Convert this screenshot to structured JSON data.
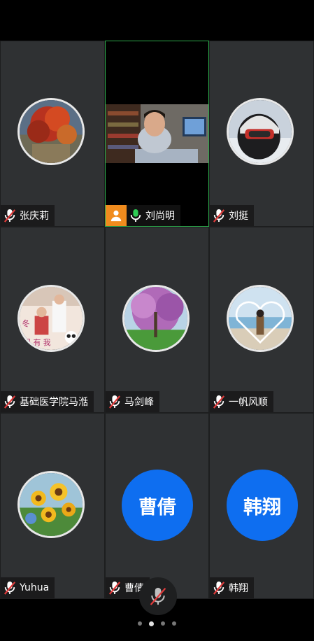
{
  "participants": [
    {
      "name": "张庆莉",
      "muted": true,
      "avatar": "red-maple-tree-photo"
    },
    {
      "name": "刘尚明",
      "muted": false,
      "host": true,
      "video": true
    },
    {
      "name": "刘挺",
      "muted": true,
      "avatar": "ski-helmet-selfie-photo"
    },
    {
      "name": "基础医学院马湉",
      "muted": true,
      "avatar": "family-illustration-photo"
    },
    {
      "name": "马剑峰",
      "muted": true,
      "avatar": "purple-blossom-tree-photo"
    },
    {
      "name": "一帆风顺",
      "muted": true,
      "avatar": "beach-heart-frame-photo"
    },
    {
      "name": "Yuhua",
      "muted": true,
      "avatar": "sunflower-painting"
    },
    {
      "name": "曹倩",
      "muted": true,
      "initials": "曹倩"
    },
    {
      "name": "韩翔",
      "muted": true,
      "initials": "韩翔"
    }
  ],
  "colors": {
    "tile_bg": "#2f3133",
    "active_border": "#2ca84a",
    "initials_bg": "#0e6ef0",
    "host_badge": "#f08c1e",
    "muted_icon": "#e23b3b",
    "unmuted_icon": "#2ecc55"
  },
  "controls": {
    "mic_state": "muted"
  },
  "pagination": {
    "total": 4,
    "current": 2
  }
}
